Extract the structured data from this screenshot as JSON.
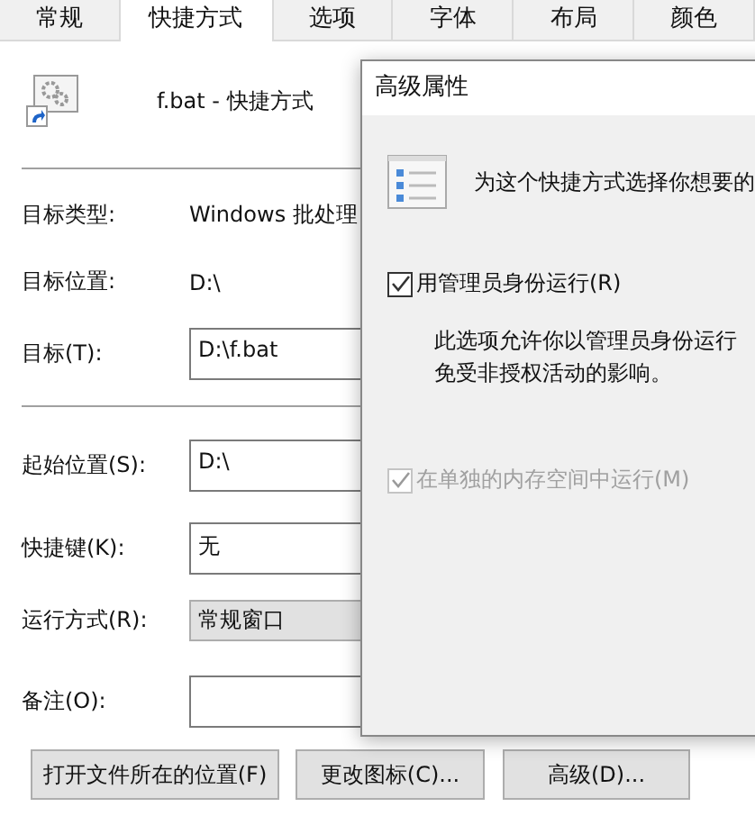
{
  "tabs": [
    {
      "label": "常规",
      "selected": false
    },
    {
      "label": "快捷方式",
      "selected": true
    },
    {
      "label": "选项",
      "selected": false
    },
    {
      "label": "字体",
      "selected": false
    },
    {
      "label": "布局",
      "selected": false
    },
    {
      "label": "颜色",
      "selected": false
    }
  ],
  "shortcut_name": "f.bat - 快捷方式",
  "info": [
    {
      "label": "目标类型:",
      "value": "Windows 批处理"
    },
    {
      "label": "目标位置:",
      "value": "D:\\"
    }
  ],
  "target": {
    "label": "目标(T):",
    "value": "D:\\f.bat"
  },
  "fields": [
    {
      "label": "起始位置(S):",
      "value": "D:\\",
      "kind": "text"
    },
    {
      "label": "快捷键(K):",
      "value": "无",
      "kind": "text"
    },
    {
      "label": "运行方式(R):",
      "value": "常规窗口",
      "kind": "dropdown"
    },
    {
      "label": "备注(O):",
      "kind": "text"
    }
  ],
  "buttons": [
    "打开文件所在的位置(F)",
    "更改图标(C)...",
    "高级(D)..."
  ],
  "dialog": {
    "title": "高级属性",
    "intro": "为这个快捷方式选择你想要的",
    "options": [
      {
        "label": "用管理员身份运行(R)",
        "checked": true,
        "disabled": false,
        "description": [
          "此选项允许你以管理员身份运行",
          "免受非授权活动的影响。"
        ]
      },
      {
        "label": "在单独的内存空间中运行(M)",
        "checked": true,
        "disabled": true
      }
    ]
  }
}
